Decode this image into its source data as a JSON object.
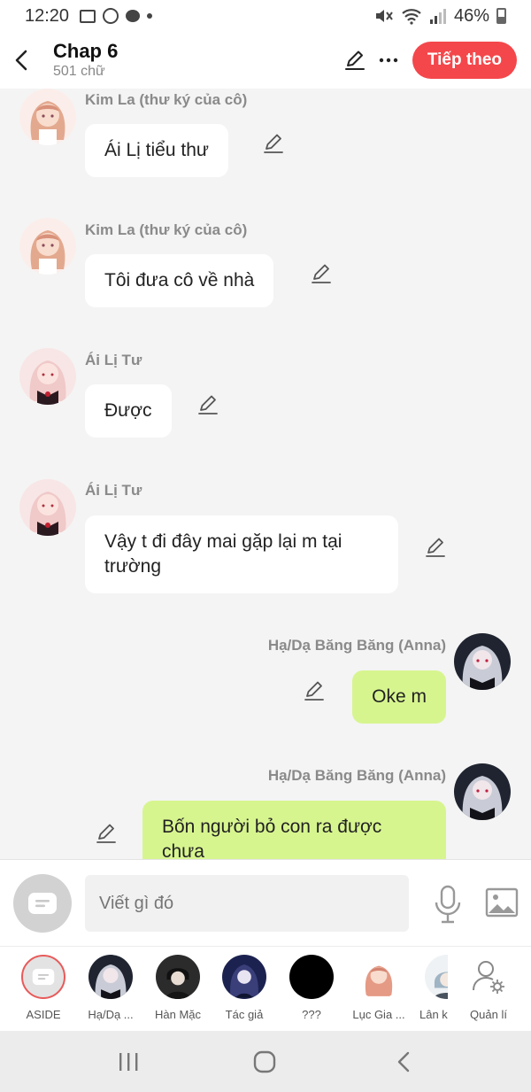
{
  "status_bar": {
    "time": "12:20",
    "battery": "46%"
  },
  "header": {
    "title": "Chap 6",
    "subtitle": "501 chữ",
    "next_label": "Tiếp theo"
  },
  "messages": [
    {
      "sender": "Kim La (thư ký của cô)",
      "text": "Ái Lị tiểu thư",
      "side": "left"
    },
    {
      "sender": "Kim La (thư ký của cô)",
      "text": "Tôi đưa cô về nhà",
      "side": "left"
    },
    {
      "sender": "Ái Lị Tư",
      "text": "Được",
      "side": "left"
    },
    {
      "sender": "Ái Lị Tư",
      "text": "Vậy t đi đây mai gặp lại m tại trường",
      "side": "left"
    },
    {
      "sender": "Hạ/Dạ Băng Băng (Anna)",
      "text": "Oke m",
      "side": "right"
    },
    {
      "sender": "Hạ/Dạ Băng Băng (Anna)",
      "text": "Bốn người bỏ con ra được chưa",
      "side": "right"
    }
  ],
  "composer": {
    "placeholder": "Viết gì đó"
  },
  "characters": [
    {
      "label": "ASIDE"
    },
    {
      "label": "Hạ/Dạ ..."
    },
    {
      "label": "Hàn Mặc"
    },
    {
      "label": "Tác giả"
    },
    {
      "label": "???"
    },
    {
      "label": "Lục Gia ..."
    },
    {
      "label": "Lân k"
    },
    {
      "label": "Quản lí"
    }
  ],
  "colors": {
    "accent": "#f4474b",
    "my_bubble": "#d7f58f",
    "other_bubble": "#ffffff",
    "background": "#f4f4f4"
  }
}
